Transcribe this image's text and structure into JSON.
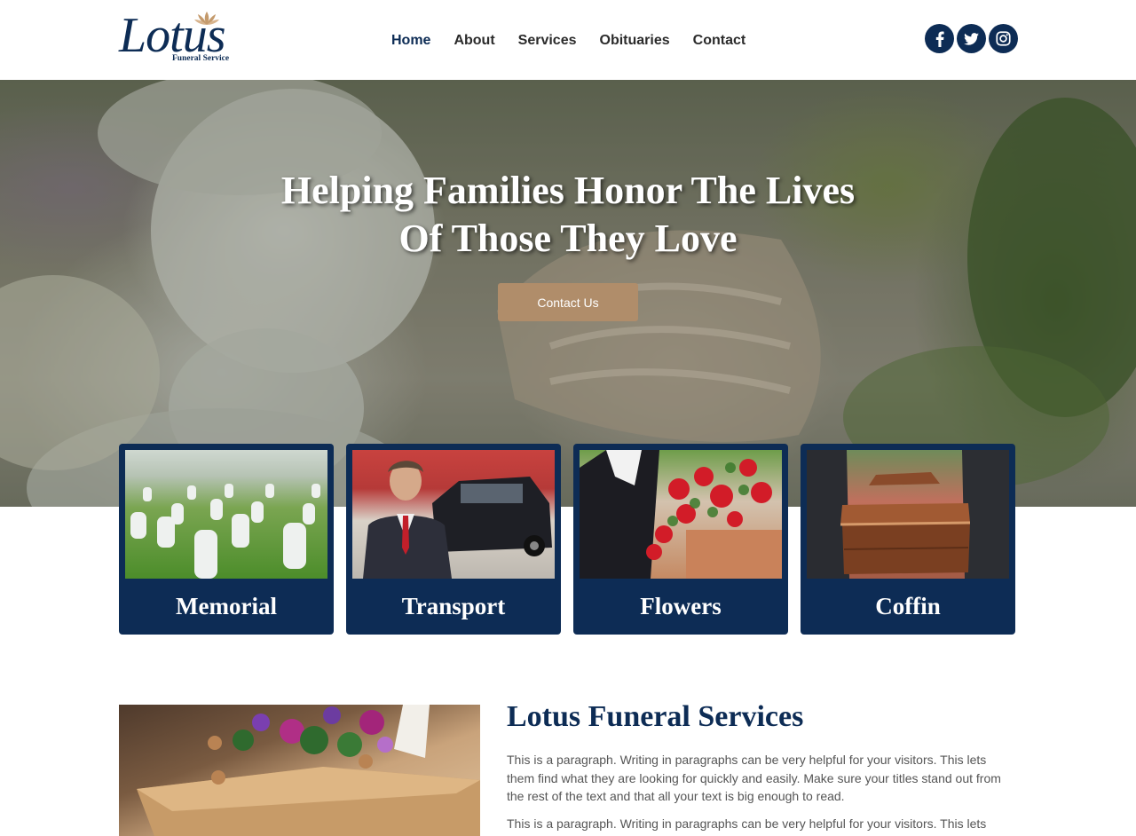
{
  "header": {
    "logo": {
      "word": "Lotus",
      "subtitle": "Funeral Service"
    },
    "nav": [
      {
        "label": "Home",
        "active": true
      },
      {
        "label": "About",
        "active": false
      },
      {
        "label": "Services",
        "active": false
      },
      {
        "label": "Obituaries",
        "active": false
      },
      {
        "label": "Contact",
        "active": false
      }
    ],
    "social": [
      "facebook-icon",
      "twitter-icon",
      "instagram-icon"
    ]
  },
  "hero": {
    "title_line1": "Helping Families Honor The Lives",
    "title_line2": "Of Those They Love",
    "cta_label": "Contact Us"
  },
  "services": [
    {
      "label": "Memorial"
    },
    {
      "label": "Transport"
    },
    {
      "label": "Flowers"
    },
    {
      "label": "Coffin"
    }
  ],
  "about": {
    "title": "Lotus Funeral Services",
    "paragraph1": "This is a paragraph. Writing in paragraphs can be very helpful for your visitors. This lets them find what they are looking for quickly and easily. Make sure your titles stand out from the rest of the text and that all your text is big enough to read.",
    "paragraph2": "This is a paragraph. Writing in paragraphs can be very helpful for your visitors. This lets them"
  },
  "colors": {
    "brand_navy": "#0d2c55",
    "accent_tan": "#b08d6a"
  }
}
